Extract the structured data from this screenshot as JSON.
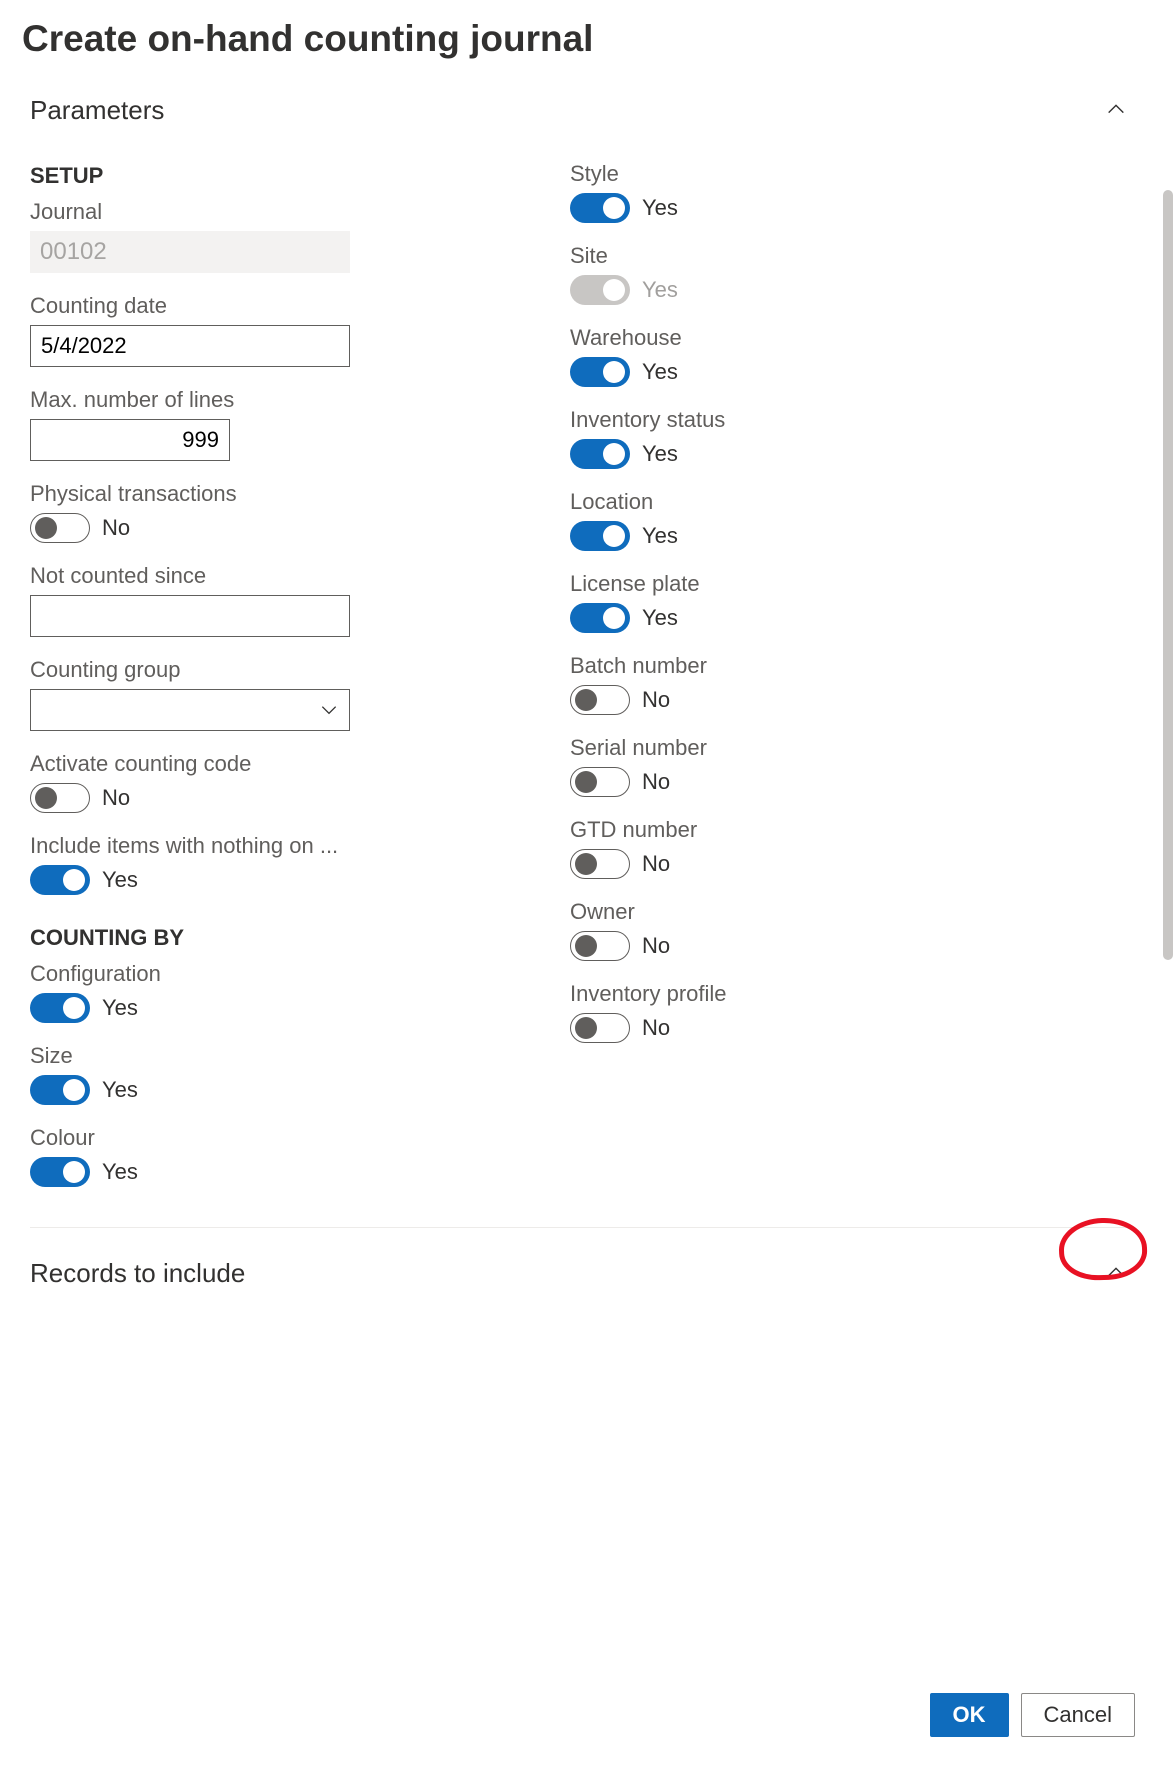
{
  "title": "Create on-hand counting journal",
  "sections": {
    "parameters": "Parameters",
    "records": "Records to include"
  },
  "groups": {
    "setup": "SETUP",
    "counting_by": "COUNTING BY"
  },
  "setup": {
    "journal_label": "Journal",
    "journal_value": "00102",
    "counting_date_label": "Counting date",
    "counting_date_value": "5/4/2022",
    "max_lines_label": "Max. number of lines",
    "max_lines_value": "999",
    "physical_trans_label": "Physical transactions",
    "physical_trans_value": "No",
    "not_counted_label": "Not counted since",
    "not_counted_value": "",
    "counting_group_label": "Counting group",
    "counting_group_value": "",
    "activate_code_label": "Activate counting code",
    "activate_code_value": "No",
    "include_nothing_label": "Include items with nothing on ...",
    "include_nothing_value": "Yes"
  },
  "counting_by": {
    "configuration": {
      "label": "Configuration",
      "value": "Yes",
      "on": true,
      "disabled": false
    },
    "size": {
      "label": "Size",
      "value": "Yes",
      "on": true,
      "disabled": false
    },
    "colour": {
      "label": "Colour",
      "value": "Yes",
      "on": true,
      "disabled": false
    },
    "style": {
      "label": "Style",
      "value": "Yes",
      "on": true,
      "disabled": false
    },
    "site": {
      "label": "Site",
      "value": "Yes",
      "on": true,
      "disabled": true
    },
    "warehouse": {
      "label": "Warehouse",
      "value": "Yes",
      "on": true,
      "disabled": false
    },
    "inventory_status": {
      "label": "Inventory status",
      "value": "Yes",
      "on": true,
      "disabled": false
    },
    "location": {
      "label": "Location",
      "value": "Yes",
      "on": true,
      "disabled": false
    },
    "license_plate": {
      "label": "License plate",
      "value": "Yes",
      "on": true,
      "disabled": false
    },
    "batch_number": {
      "label": "Batch number",
      "value": "No",
      "on": false,
      "disabled": false
    },
    "serial_number": {
      "label": "Serial number",
      "value": "No",
      "on": false,
      "disabled": false
    },
    "gtd_number": {
      "label": "GTD number",
      "value": "No",
      "on": false,
      "disabled": false
    },
    "owner": {
      "label": "Owner",
      "value": "No",
      "on": false,
      "disabled": false
    },
    "inventory_profile": {
      "label": "Inventory profile",
      "value": "No",
      "on": false,
      "disabled": false
    }
  },
  "buttons": {
    "ok": "OK",
    "cancel": "Cancel"
  }
}
